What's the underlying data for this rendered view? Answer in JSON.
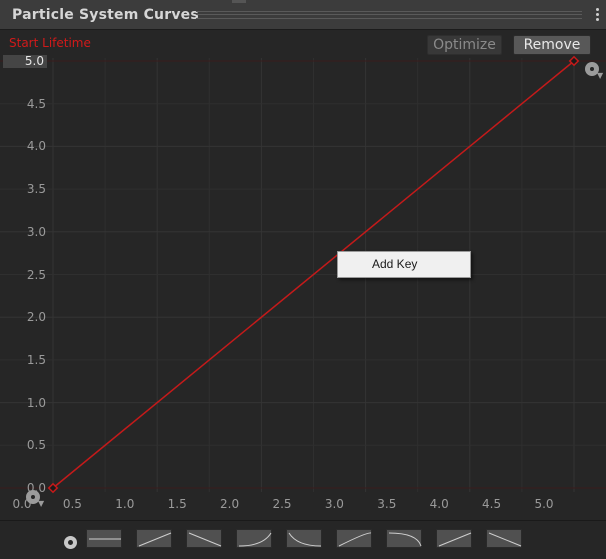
{
  "window": {
    "title": "Particle System Curves"
  },
  "curve": {
    "label": "Start Lifetime",
    "value_field": "5.0",
    "color": "#c41a1a"
  },
  "toolbar": {
    "optimize_label": "Optimize",
    "remove_label": "Remove"
  },
  "axes": {
    "y_ticks": [
      "4.5",
      "4.0",
      "3.5",
      "3.0",
      "2.5",
      "2.0",
      "1.5",
      "1.0",
      "0.5",
      "0.0"
    ],
    "x_ticks": [
      "0.0",
      "0.5",
      "1.0",
      "1.5",
      "2.0",
      "2.5",
      "3.0",
      "3.5",
      "4.0",
      "4.5",
      "5.0"
    ]
  },
  "context_menu": {
    "items": [
      "Add Key"
    ]
  },
  "presets": {
    "names": [
      "flat",
      "linear-up",
      "linear-down",
      "ease-in",
      "ease-out",
      "ease-in-out",
      "smooth-down",
      "linear-up-2",
      "linear-down-2"
    ]
  },
  "chart_data": {
    "type": "line",
    "x": [
      0.0,
      5.0
    ],
    "y": [
      0.0,
      5.0
    ],
    "series": [
      {
        "name": "Start Lifetime",
        "values": [
          0.0,
          5.0
        ]
      }
    ],
    "xlim": [
      0.0,
      5.0
    ],
    "ylim": [
      0.0,
      5.0
    ],
    "grid": true
  }
}
